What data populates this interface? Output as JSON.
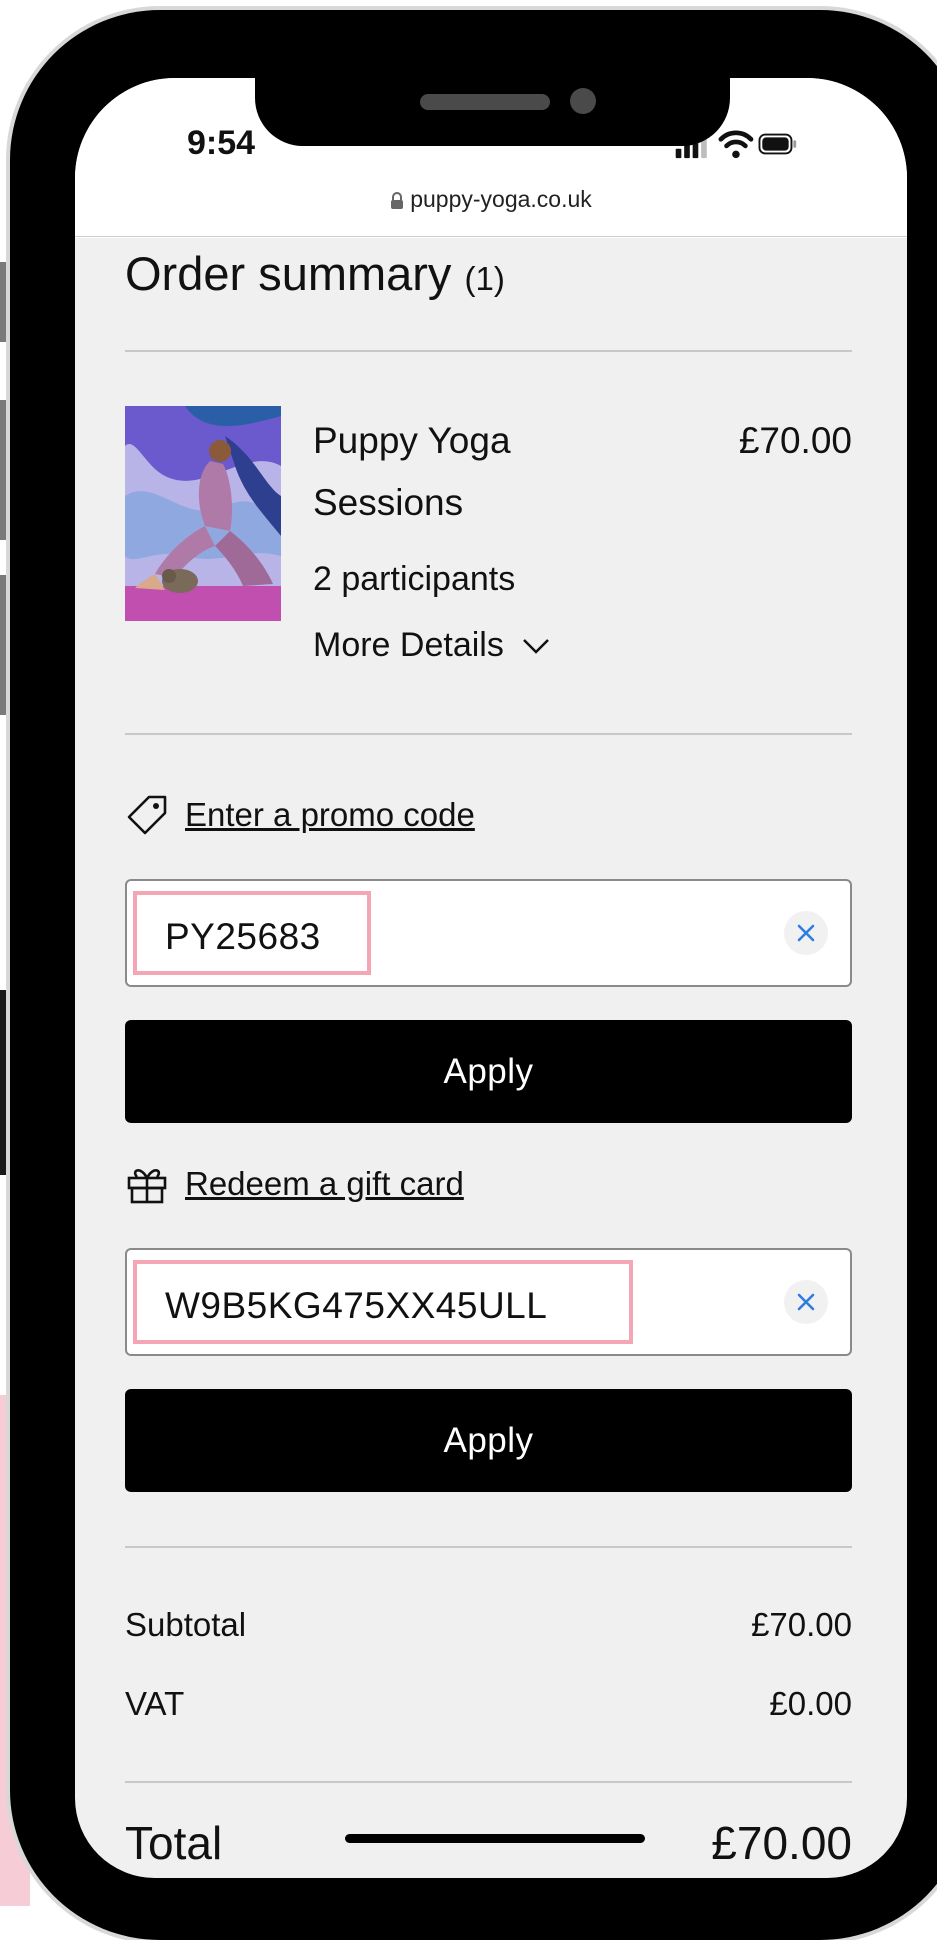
{
  "status_bar": {
    "time": "9:54",
    "icons": [
      "signal-icon",
      "wifi-icon",
      "battery-icon"
    ]
  },
  "browser": {
    "url": "puppy-yoga.co.uk"
  },
  "order": {
    "title": "Order summary",
    "count": "(1)",
    "item": {
      "name": "Puppy Yoga Sessions",
      "price": "£70.00",
      "participants": "2 participants",
      "more_details": "More Details"
    }
  },
  "promo": {
    "link_label": "Enter a promo code",
    "value": "PY25683",
    "apply_label": "Apply"
  },
  "gift_card": {
    "link_label": "Redeem a gift card",
    "value": "W9B5KG475XX45ULL",
    "apply_label": "Apply"
  },
  "totals": {
    "subtotal_label": "Subtotal",
    "subtotal_value": "£70.00",
    "vat_label": "VAT",
    "vat_value": "£0.00",
    "total_label": "Total",
    "total_value": "£70.00"
  },
  "colors": {
    "highlight": "#f4a6b5",
    "clear_icon": "#2f7de1",
    "button": "#000000"
  }
}
